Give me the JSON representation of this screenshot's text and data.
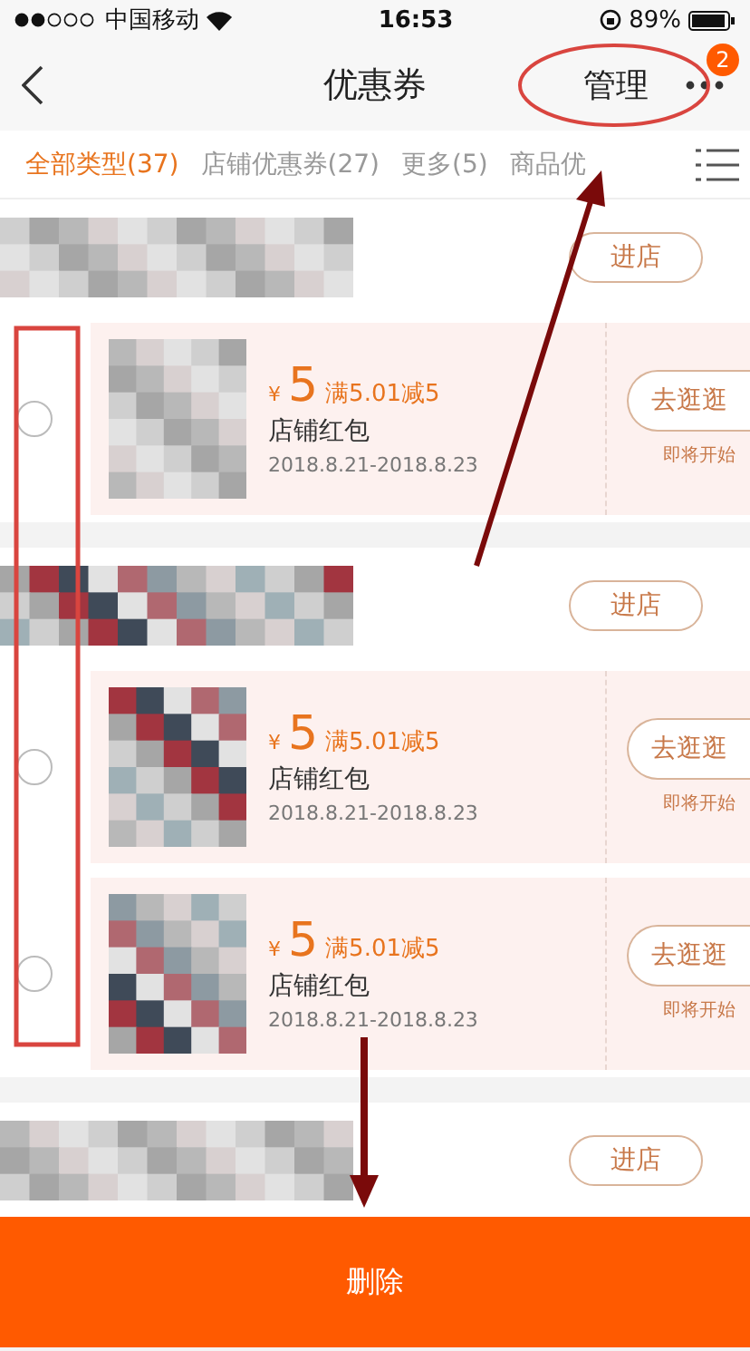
{
  "status_bar": {
    "carrier": "中国移动",
    "time": "16:53",
    "battery": "89%"
  },
  "nav": {
    "title": "优惠券",
    "action": "管理",
    "badge": "2"
  },
  "tabs": [
    {
      "label": "全部类型(37)",
      "selected": true
    },
    {
      "label": "店铺优惠券(27)",
      "selected": false
    },
    {
      "label": "更多(5)",
      "selected": false
    },
    {
      "label": "商品优",
      "selected": false
    }
  ],
  "shops": [
    {
      "button": "进店",
      "coupons": [
        {
          "currency": "¥",
          "amount": "5",
          "condition": "满5.01减5",
          "name": "店铺红包",
          "dates": "2018.8.21-2018.8.23",
          "action": "去逛逛",
          "status": "即将开始",
          "checked": false
        }
      ]
    },
    {
      "button": "进店",
      "coupons": [
        {
          "currency": "¥",
          "amount": "5",
          "condition": "满5.01减5",
          "name": "店铺红包",
          "dates": "2018.8.21-2018.8.23",
          "action": "去逛逛",
          "status": "即将开始",
          "checked": false
        },
        {
          "currency": "¥",
          "amount": "5",
          "condition": "满5.01减5",
          "name": "店铺红包",
          "dates": "2018.8.21-2018.8.23",
          "action": "去逛逛",
          "status": "即将开始",
          "checked": false
        }
      ]
    },
    {
      "button": "进店"
    }
  ],
  "bottom_bar": {
    "button": "删除"
  }
}
